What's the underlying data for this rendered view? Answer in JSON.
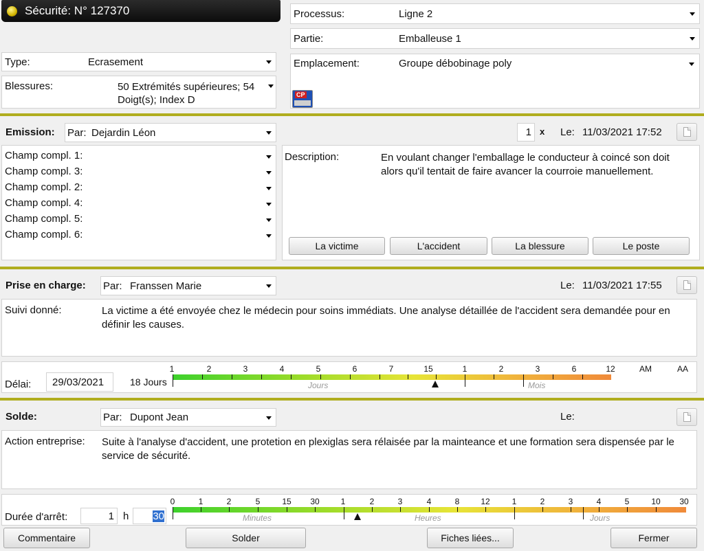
{
  "header": {
    "title": "Sécurité: N° 127370"
  },
  "fields": {
    "processus_label": "Processus:",
    "processus_value": "Ligne 2",
    "partie_label": "Partie:",
    "partie_value": "Emballeuse 1",
    "emplacement_label": "Emplacement:",
    "emplacement_value": "Groupe débobinage poly",
    "type_label": "Type:",
    "type_value": "Ecrasement",
    "blessures_label": "Blessures:",
    "blessures_value": "50 Extrémités supérieures; 54 Doigt(s); Index D",
    "badge_text": "CP"
  },
  "emission": {
    "label": "Emission:",
    "par_label": "Par:",
    "par_value": "Dejardin Léon",
    "count": "1",
    "count_suffix": "x",
    "le_label": "Le:",
    "date": "11/03/2021 17:52",
    "champs": [
      "Champ compl. 1:",
      "Champ compl. 3:",
      "Champ compl. 2:",
      "Champ compl. 4:",
      "Champ compl. 5:",
      "Champ compl. 6:"
    ],
    "description_label": "Description:",
    "description": "En voulant changer l'emballage le conducteur à coincé son doit alors qu'il tentait de faire avancer la courroie manuellement.",
    "buttons": [
      "La victime",
      "L'accident",
      "La blessure",
      "Le poste"
    ]
  },
  "prise": {
    "label": "Prise en charge:",
    "par_label": "Par:",
    "par_value": "Franssen Marie",
    "le_label": "Le:",
    "date": "11/03/2021 17:55",
    "suivi_label": "Suivi donné:",
    "suivi": "La victime a été envoyée chez le médecin pour soins immédiats.  Une analyse détaillée de l'accident sera demandée pour en définir les causes.",
    "delai_label": "Délai:",
    "delai_value": "29/03/2021",
    "delai_days": "18 Jours",
    "scale_labels": [
      "1",
      "2",
      "3",
      "4",
      "5",
      "6",
      "7",
      "15",
      "1",
      "2",
      "3",
      "6",
      "12",
      "AM",
      "AA"
    ],
    "unit_jours": "Jours",
    "unit_mois": "Mois",
    "marker_value_days": 18
  },
  "solde": {
    "label": "Solde:",
    "par_label": "Par:",
    "par_value": "Dupont Jean",
    "le_label": "Le:",
    "action_label": "Action entreprise:",
    "action": "Suite à l'analyse d'accident, une protetion en plexiglas sera rélaisée par la mainteance et une formation sera dispensée par le service de sécurité.",
    "duree_label": "Durée d'arrêt:",
    "duree_hours": "1",
    "h_label": "h",
    "duree_minutes": "30",
    "scale_labels": [
      "0",
      "1",
      "2",
      "5",
      "15",
      "30",
      "1",
      "2",
      "3",
      "4",
      "8",
      "12",
      "1",
      "2",
      "3",
      "4",
      "5",
      "10",
      "30"
    ],
    "unit_minutes": "Minutes",
    "unit_heures": "Heures",
    "unit_jours": "Jours",
    "marker_value_hours": 1.5
  },
  "footer": {
    "commentaire": "Commentaire",
    "solder": "Solder",
    "fiches": "Fiches liées...",
    "fermer": "Fermer"
  },
  "colors": {
    "separator": "#b0ad1e",
    "title_bg": "#1a1a1a",
    "selection": "#3070d0"
  }
}
